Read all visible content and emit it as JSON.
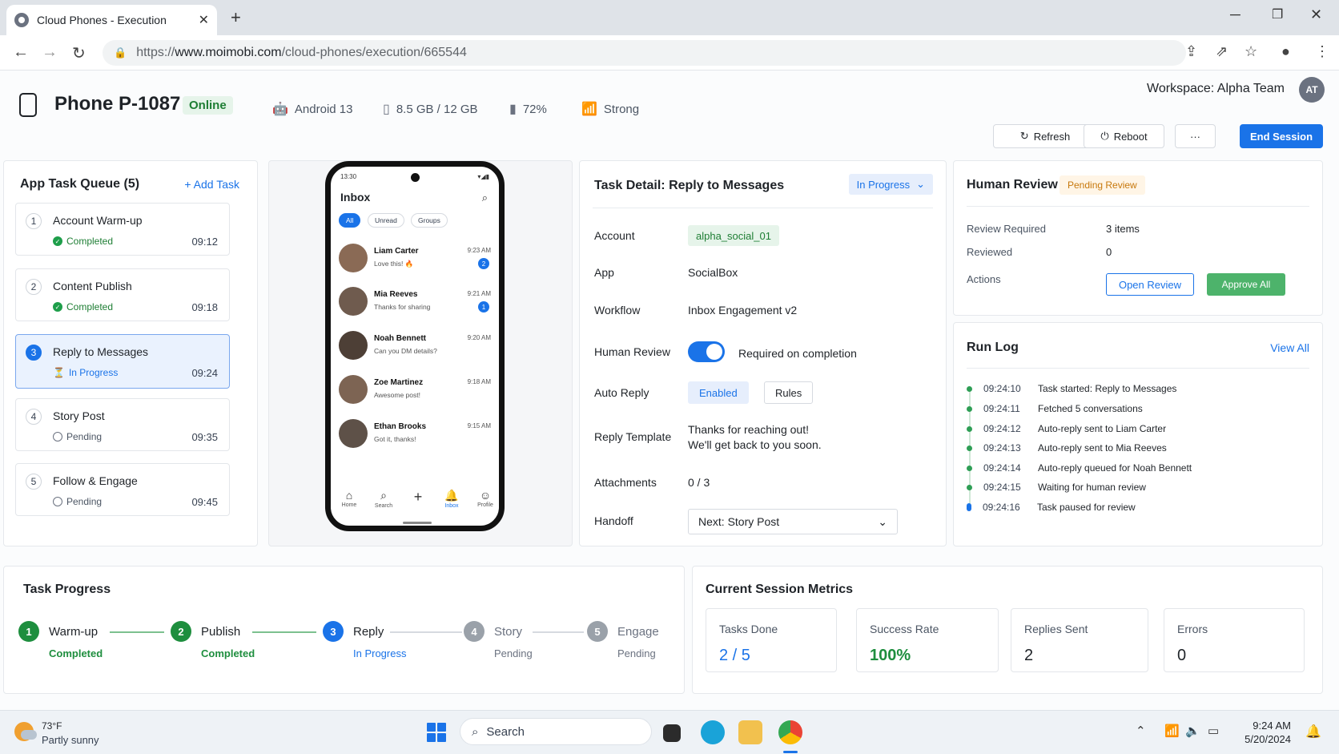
{
  "browser": {
    "tab_title": "Cloud Phones - Execution",
    "url_prefix": "https://",
    "url_host": "www.moimobi.com",
    "url_path": "/cloud-phones/execution/665544"
  },
  "header": {
    "phone_name": "Phone P-1087",
    "status": "Online",
    "os": "Android 13",
    "storage": "8.5 GB / 12 GB",
    "battery": "72%",
    "signal": "Strong",
    "workspace": "Workspace: Alpha Team",
    "avatar": "AT",
    "buttons": {
      "refresh": "Refresh",
      "reboot": "Reboot",
      "more": "···",
      "end_session": "End Session"
    }
  },
  "queue": {
    "title": "App Task Queue (5)",
    "add_label": "+ Add Task",
    "items": [
      {
        "num": "1",
        "name": "Account Warm-up",
        "status": "Completed",
        "time": "09:12"
      },
      {
        "num": "2",
        "name": "Content Publish",
        "status": "Completed",
        "time": "09:18"
      },
      {
        "num": "3",
        "name": "Reply to Messages",
        "status": "In Progress",
        "time": "09:24"
      },
      {
        "num": "4",
        "name": "Story Post",
        "status": "Pending",
        "time": "09:35"
      },
      {
        "num": "5",
        "name": "Follow & Engage",
        "status": "Pending",
        "time": "09:45"
      }
    ]
  },
  "device": {
    "status_time": "13:30",
    "status_icons": "▾◢▮",
    "inbox_title": "Inbox",
    "chips": [
      "All",
      "Unread",
      "Groups"
    ],
    "conversations": [
      {
        "name": "Liam Carter",
        "message": "Love this! 🔥",
        "time": "9:23 AM",
        "badge": "2"
      },
      {
        "name": "Mia Reeves",
        "message": "Thanks for sharing",
        "time": "9:21 AM",
        "badge": "1"
      },
      {
        "name": "Noah Bennett",
        "message": "Can you DM details?",
        "time": "9:20 AM",
        "badge": ""
      },
      {
        "name": "Zoe Martinez",
        "message": "Awesome post!",
        "time": "9:18 AM",
        "badge": ""
      },
      {
        "name": "Ethan Brooks",
        "message": "Got it, thanks!",
        "time": "9:15 AM",
        "badge": ""
      }
    ],
    "nav": [
      "Home",
      "Search",
      "",
      "Inbox",
      "Profile"
    ]
  },
  "task_detail": {
    "title": "Task Detail: Reply to Messages",
    "status": "In Progress",
    "labels": {
      "account": "Account",
      "app": "App",
      "workflow": "Workflow",
      "human_review": "Human Review",
      "auto_reply": "Auto Reply",
      "reply_template": "Reply Template",
      "attachments": "Attachments",
      "handoff": "Handoff"
    },
    "account": "alpha_social_01",
    "app": "SocialBox",
    "workflow": "Inbox Engagement v2",
    "human_review_text": "Required on completion",
    "human_review_enabled": true,
    "auto_reply_enabled": "Enabled",
    "auto_reply_rules": "Rules",
    "reply_template_line1": "Thanks for reaching out!",
    "reply_template_line2": "We'll get back to you soon.",
    "attachments": "0 / 3",
    "handoff": "Next: Story Post"
  },
  "human_review": {
    "title": "Human Review",
    "badge": "Pending Review",
    "labels": {
      "required": "Review Required",
      "reviewed": "Reviewed",
      "actions": "Actions"
    },
    "required": "3 items",
    "reviewed": "0",
    "open_review": "Open Review",
    "approve_all": "Approve All"
  },
  "run_log": {
    "title": "Run Log",
    "view_all": "View All",
    "entries": [
      {
        "time": "09:24:10",
        "text": "Task started: Reply to Messages"
      },
      {
        "time": "09:24:11",
        "text": "Fetched 5 conversations"
      },
      {
        "time": "09:24:12",
        "text": "Auto-reply sent to Liam Carter"
      },
      {
        "time": "09:24:13",
        "text": "Auto-reply sent to Mia Reeves"
      },
      {
        "time": "09:24:14",
        "text": "Auto-reply queued for Noah Bennett"
      },
      {
        "time": "09:24:15",
        "text": "Waiting for human review"
      },
      {
        "time": "09:24:16",
        "text": "Task paused for review"
      }
    ]
  },
  "task_progress": {
    "title": "Task Progress",
    "steps": [
      {
        "num": "1",
        "label": "Warm-up",
        "status": "Completed"
      },
      {
        "num": "2",
        "label": "Publish",
        "status": "Completed"
      },
      {
        "num": "3",
        "label": "Reply",
        "status": "In Progress"
      },
      {
        "num": "4",
        "label": "Story",
        "status": "Pending"
      },
      {
        "num": "5",
        "label": "Engage",
        "status": "Pending"
      }
    ]
  },
  "metrics": {
    "title": "Current Session Metrics",
    "items": [
      {
        "label": "Tasks Done",
        "value": "2 / 5"
      },
      {
        "label": "Success Rate",
        "value": "100%"
      },
      {
        "label": "Replies Sent",
        "value": "2"
      },
      {
        "label": "Errors",
        "value": "0"
      }
    ]
  },
  "taskbar": {
    "temp": "73°F",
    "weather": "Partly sunny",
    "search": "Search",
    "time": "9:24 AM",
    "date": "5/20/2024"
  },
  "colors": {
    "accent": "#1a73e8",
    "success": "#1e8e3e",
    "warning": "#c7780c"
  }
}
